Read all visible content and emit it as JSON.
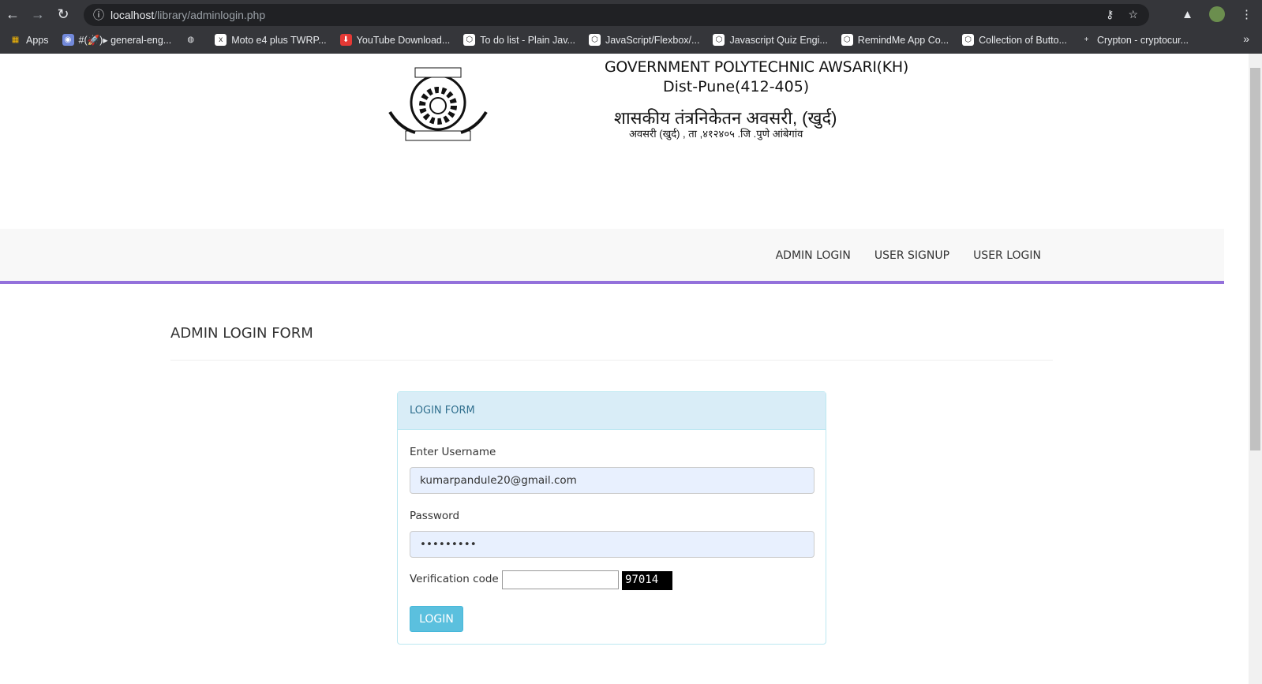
{
  "browser": {
    "url_host": "localhost",
    "url_path": "/library/adminlogin.php",
    "bookmarks": [
      {
        "label": "Apps",
        "icon": "apps-grid-icon"
      },
      {
        "label": "#(🚀)▸ general-eng...",
        "icon": "discord-icon"
      },
      {
        "label": "",
        "icon": "globe-icon"
      },
      {
        "label": "Moto e4 plus TWRP...",
        "icon": "xda-icon"
      },
      {
        "label": "YouTube Download...",
        "icon": "download-icon"
      },
      {
        "label": "To do list - Plain Jav...",
        "icon": "codepen-icon"
      },
      {
        "label": "JavaScript/Flexbox/...",
        "icon": "codepen-icon"
      },
      {
        "label": "Javascript Quiz Engi...",
        "icon": "codepen-icon"
      },
      {
        "label": "RemindMe App Co...",
        "icon": "codepen-icon"
      },
      {
        "label": "Collection of Butto...",
        "icon": "codepen-icon"
      },
      {
        "label": "Crypton - cryptocur...",
        "icon": "crypton-icon"
      }
    ]
  },
  "header": {
    "title_en": "GOVERNMENT POLYTECHNIC AWSARI(KH)",
    "district": "Dist-Pune(412-405)",
    "title_mr": "शासकीय  तंत्रनिकेतन अवसरी, (खुर्द)",
    "address_mr": "अवसरी (खुर्द) , ता ,४१२४०५ .जि .पुणे  आंबेगांव",
    "logo_text": "महाराष्ट्र शासन तंत्रशिक्षण संचालनालय"
  },
  "nav": [
    "ADMIN LOGIN",
    "USER SIGNUP",
    "USER LOGIN"
  ],
  "colors": {
    "accent": "#9370db",
    "panel_heading": "#d9edf7",
    "button": "#5bc0de"
  },
  "page_title": "ADMIN LOGIN FORM",
  "form": {
    "heading": "LOGIN FORM",
    "username_label": "Enter Username",
    "username_value": "kumarpandule20@gmail.com",
    "password_label": "Password",
    "password_value": "•••••••••",
    "verify_label": "Verification code :",
    "verify_value": "",
    "captcha": "97014",
    "login_label": "LOGIN"
  }
}
